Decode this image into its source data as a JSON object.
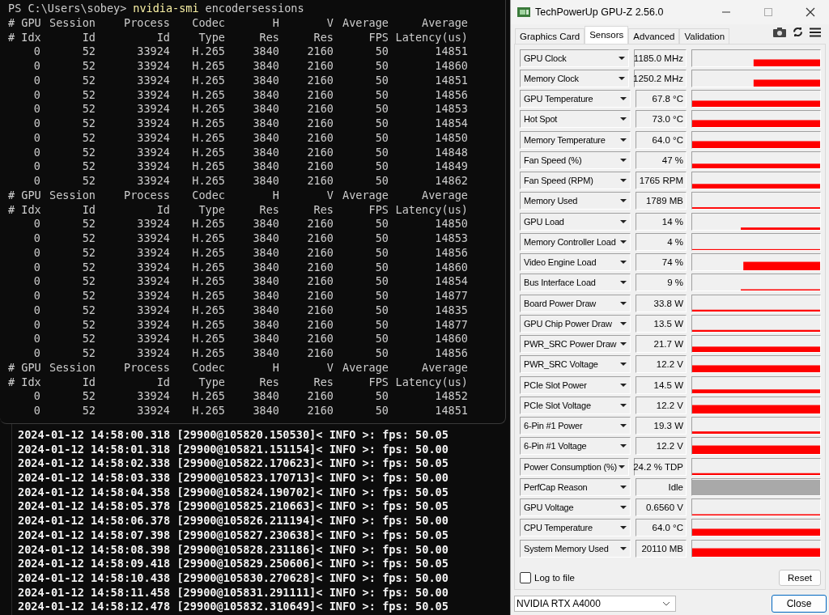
{
  "terminal": {
    "prompt": "PS C:\\Users\\sobey>",
    "command": "nvidia-smi",
    "argument": "encodersessions",
    "blocks": [
      {
        "headers": [
          [
            "# GPU",
            "Session",
            "Process",
            "Codec",
            "H",
            "V",
            "Average",
            "Average"
          ],
          [
            "# Idx",
            "Id",
            "Id",
            "Type",
            "Res",
            "Res",
            "FPS",
            "Latency(us)"
          ]
        ],
        "rows": [
          [
            "0",
            "52",
            "33924",
            "H.265",
            "3840",
            "2160",
            "50",
            "14851"
          ],
          [
            "0",
            "52",
            "33924",
            "H.265",
            "3840",
            "2160",
            "50",
            "14860"
          ],
          [
            "0",
            "52",
            "33924",
            "H.265",
            "3840",
            "2160",
            "50",
            "14851"
          ],
          [
            "0",
            "52",
            "33924",
            "H.265",
            "3840",
            "2160",
            "50",
            "14856"
          ],
          [
            "0",
            "52",
            "33924",
            "H.265",
            "3840",
            "2160",
            "50",
            "14853"
          ],
          [
            "0",
            "52",
            "33924",
            "H.265",
            "3840",
            "2160",
            "50",
            "14854"
          ],
          [
            "0",
            "52",
            "33924",
            "H.265",
            "3840",
            "2160",
            "50",
            "14850"
          ],
          [
            "0",
            "52",
            "33924",
            "H.265",
            "3840",
            "2160",
            "50",
            "14848"
          ],
          [
            "0",
            "52",
            "33924",
            "H.265",
            "3840",
            "2160",
            "50",
            "14849"
          ],
          [
            "0",
            "52",
            "33924",
            "H.265",
            "3840",
            "2160",
            "50",
            "14862"
          ]
        ]
      },
      {
        "headers": [
          [
            "# GPU",
            "Session",
            "Process",
            "Codec",
            "H",
            "V",
            "Average",
            "Average"
          ],
          [
            "# Idx",
            "Id",
            "Id",
            "Type",
            "Res",
            "Res",
            "FPS",
            "Latency(us)"
          ]
        ],
        "rows": [
          [
            "0",
            "52",
            "33924",
            "H.265",
            "3840",
            "2160",
            "50",
            "14850"
          ],
          [
            "0",
            "52",
            "33924",
            "H.265",
            "3840",
            "2160",
            "50",
            "14853"
          ],
          [
            "0",
            "52",
            "33924",
            "H.265",
            "3840",
            "2160",
            "50",
            "14856"
          ],
          [
            "0",
            "52",
            "33924",
            "H.265",
            "3840",
            "2160",
            "50",
            "14860"
          ],
          [
            "0",
            "52",
            "33924",
            "H.265",
            "3840",
            "2160",
            "50",
            "14854"
          ],
          [
            "0",
            "52",
            "33924",
            "H.265",
            "3840",
            "2160",
            "50",
            "14877"
          ],
          [
            "0",
            "52",
            "33924",
            "H.265",
            "3840",
            "2160",
            "50",
            "14835"
          ],
          [
            "0",
            "52",
            "33924",
            "H.265",
            "3840",
            "2160",
            "50",
            "14877"
          ],
          [
            "0",
            "52",
            "33924",
            "H.265",
            "3840",
            "2160",
            "50",
            "14860"
          ],
          [
            "0",
            "52",
            "33924",
            "H.265",
            "3840",
            "2160",
            "50",
            "14856"
          ]
        ]
      },
      {
        "headers": [
          [
            "# GPU",
            "Session",
            "Process",
            "Codec",
            "H",
            "V",
            "Average",
            "Average"
          ],
          [
            "# Idx",
            "Id",
            "Id",
            "Type",
            "Res",
            "Res",
            "FPS",
            "Latency(us)"
          ]
        ],
        "rows": [
          [
            "0",
            "52",
            "33924",
            "H.265",
            "3840",
            "2160",
            "50",
            "14852"
          ],
          [
            "0",
            "52",
            "33924",
            "H.265",
            "3840",
            "2160",
            "50",
            "14851"
          ]
        ]
      }
    ]
  },
  "log_console": {
    "lines": [
      "2024-01-12 14:58:00.318 [29900@105820.150530]< INFO >: fps: 50.05",
      "2024-01-12 14:58:01.318 [29900@105821.151154]< INFO >: fps: 50.00",
      "2024-01-12 14:58:02.338 [29900@105822.170623]< INFO >: fps: 50.05",
      "2024-01-12 14:58:03.338 [29900@105823.170713]< INFO >: fps: 50.00",
      "2024-01-12 14:58:04.358 [29900@105824.190702]< INFO >: fps: 50.05",
      "2024-01-12 14:58:05.378 [29900@105825.210663]< INFO >: fps: 50.05",
      "2024-01-12 14:58:06.378 [29900@105826.211194]< INFO >: fps: 50.00",
      "2024-01-12 14:58:07.398 [29900@105827.230638]< INFO >: fps: 50.05",
      "2024-01-12 14:58:08.398 [29900@105828.231186]< INFO >: fps: 50.00",
      "2024-01-12 14:58:09.418 [29900@105829.250606]< INFO >: fps: 50.05",
      "2024-01-12 14:58:10.438 [29900@105830.270628]< INFO >: fps: 50.00",
      "2024-01-12 14:58:11.458 [29900@105831.291111]< INFO >: fps: 50.00",
      "2024-01-12 14:58:12.478 [29900@105832.310649]< INFO >: fps: 50.05"
    ]
  },
  "gpuz": {
    "window": {
      "title": "TechPowerUp GPU-Z 2.56.0"
    },
    "tabs": [
      {
        "label": "Graphics Card",
        "selected": false
      },
      {
        "label": "Sensors",
        "selected": true
      },
      {
        "label": "Advanced",
        "selected": false
      },
      {
        "label": "Validation",
        "selected": false
      }
    ],
    "sensors": [
      {
        "name": "GPU Clock",
        "value": "1185.0 MHz"
      },
      {
        "name": "Memory Clock",
        "value": "1250.2 MHz"
      },
      {
        "name": "GPU Temperature",
        "value": "67.8 °C"
      },
      {
        "name": "Hot Spot",
        "value": "73.0 °C"
      },
      {
        "name": "Memory Temperature",
        "value": "64.0 °C"
      },
      {
        "name": "Fan Speed (%)",
        "value": "47 %"
      },
      {
        "name": "Fan Speed (RPM)",
        "value": "1765 RPM"
      },
      {
        "name": "Memory Used",
        "value": "1789 MB"
      },
      {
        "name": "GPU Load",
        "value": "14 %"
      },
      {
        "name": "Memory Controller Load",
        "value": "4 %"
      },
      {
        "name": "Video Engine Load",
        "value": "74 %"
      },
      {
        "name": "Bus Interface Load",
        "value": "9 %"
      },
      {
        "name": "Board Power Draw",
        "value": "33.8 W"
      },
      {
        "name": "GPU Chip Power Draw",
        "value": "13.5 W"
      },
      {
        "name": "PWR_SRC Power Draw",
        "value": "21.7 W"
      },
      {
        "name": "PWR_SRC Voltage",
        "value": "12.2 V"
      },
      {
        "name": "PCIe Slot Power",
        "value": "14.5 W"
      },
      {
        "name": "PCIe Slot Voltage",
        "value": "12.2 V"
      },
      {
        "name": "6-Pin #1 Power",
        "value": "19.3 W"
      },
      {
        "name": "6-Pin #1 Voltage",
        "value": "12.2 V"
      },
      {
        "name": "Power Consumption (%)",
        "value": "24.2 % TDP"
      },
      {
        "name": "PerfCap Reason",
        "value": "Idle"
      },
      {
        "name": "GPU Voltage",
        "value": "0.6560 V"
      },
      {
        "name": "CPU Temperature",
        "value": "64.0 °C"
      },
      {
        "name": "System Memory Used",
        "value": "20110 MB"
      }
    ],
    "log_to_file": {
      "label": "Log to file",
      "checked": false
    },
    "reset_button": "Reset",
    "device": "NVIDIA RTX A4000",
    "close_button": "Close"
  }
}
